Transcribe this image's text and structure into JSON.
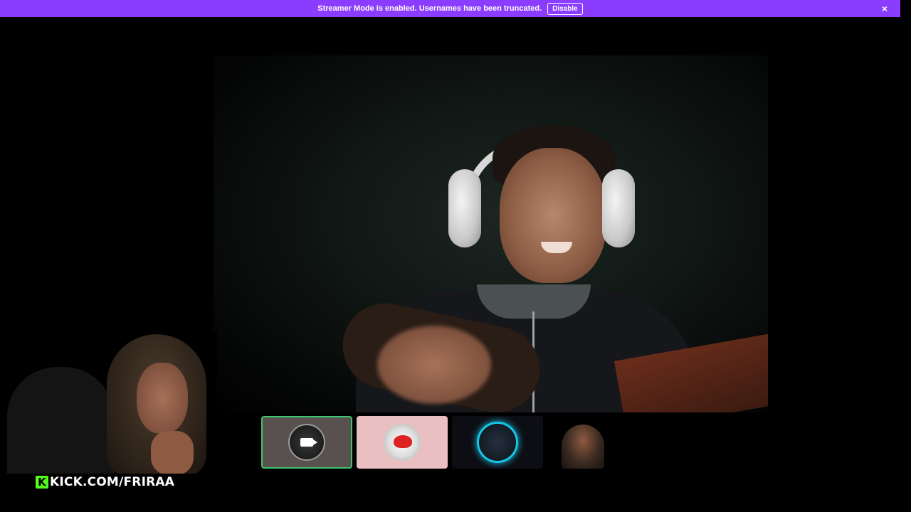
{
  "banner": {
    "message": "Streamer Mode is enabled. Usernames have been truncated.",
    "disable_label": "Disable",
    "close_icon": "×",
    "accent_color": "#8b3dff"
  },
  "overlay": {
    "brand_logo_letter": "K",
    "brand_text": "KICK.COM/FRIRAA",
    "brand_color": "#53fc18"
  },
  "participants": [
    {
      "name": "participant-camera-tile",
      "icon": "video-camera-icon",
      "active": true,
      "highlight_color": "#3ec46d"
    },
    {
      "name": "participant-avatar-tile",
      "icon": "avatar-icon",
      "active": false
    },
    {
      "name": "participant-avatar-tile",
      "icon": "avatar-icon",
      "active": false
    },
    {
      "name": "participant-video-tile",
      "icon": "video-thumbnail",
      "active": false
    }
  ]
}
